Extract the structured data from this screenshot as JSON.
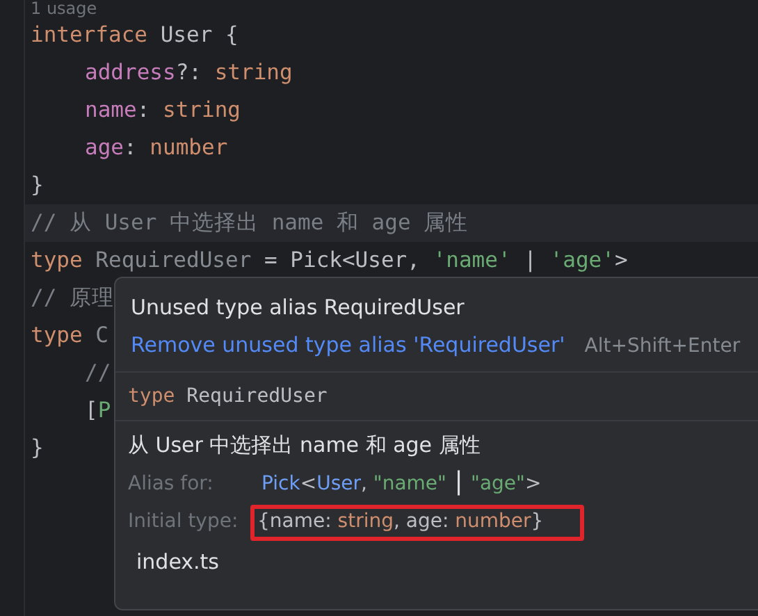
{
  "editor": {
    "usage_hint": "1 usage",
    "lines": [
      {
        "highlighted": false,
        "tokens": [
          {
            "kind": "keyword",
            "text": "interface "
          },
          {
            "kind": "plain",
            "text": "User {"
          }
        ]
      },
      {
        "highlighted": false,
        "indent": true,
        "tokens": [
          {
            "kind": "prop",
            "text": "address"
          },
          {
            "kind": "plain",
            "text": "?: "
          },
          {
            "kind": "keyword",
            "text": "string"
          }
        ]
      },
      {
        "highlighted": false,
        "indent": true,
        "tokens": [
          {
            "kind": "prop",
            "text": "name"
          },
          {
            "kind": "plain",
            "text": ": "
          },
          {
            "kind": "keyword",
            "text": "string"
          }
        ]
      },
      {
        "highlighted": false,
        "indent": true,
        "tokens": [
          {
            "kind": "prop",
            "text": "age"
          },
          {
            "kind": "plain",
            "text": ": "
          },
          {
            "kind": "keyword",
            "text": "number"
          }
        ]
      },
      {
        "highlighted": false,
        "tokens": [
          {
            "kind": "plain",
            "text": "}"
          }
        ]
      },
      {
        "highlighted": true,
        "tokens": [
          {
            "kind": "comment",
            "text": "// 从 User 中选择出 name 和 age 属性"
          }
        ]
      },
      {
        "highlighted": false,
        "tokens": [
          {
            "kind": "keyword",
            "text": "type "
          },
          {
            "kind": "unused",
            "text": "RequiredUser"
          },
          {
            "kind": "plain",
            "text": " = Pick<User, "
          },
          {
            "kind": "string",
            "text": "'name'"
          },
          {
            "kind": "plain",
            "text": " | "
          },
          {
            "kind": "string",
            "text": "'age'"
          },
          {
            "kind": "plain",
            "text": ">"
          }
        ]
      },
      {
        "highlighted": false,
        "tokens": [
          {
            "kind": "comment",
            "text": "// 原理"
          }
        ]
      },
      {
        "highlighted": false,
        "tokens": [
          {
            "kind": "keyword",
            "text": "type "
          },
          {
            "kind": "unused",
            "text": "C"
          }
        ]
      },
      {
        "highlighted": false,
        "indent": true,
        "tokens": [
          {
            "kind": "comment",
            "text": "//"
          }
        ]
      },
      {
        "highlighted": false,
        "indent": true,
        "tokens": [
          {
            "kind": "plain",
            "text": "["
          },
          {
            "kind": "string",
            "text": "P"
          }
        ]
      },
      {
        "highlighted": false,
        "tokens": [
          {
            "kind": "plain",
            "text": "}"
          }
        ]
      }
    ]
  },
  "popup": {
    "problem": "Unused type alias RequiredUser",
    "fix": {
      "label": "Remove unused type alias 'RequiredUser'",
      "shortcut": "Alt+Shift+Enter"
    },
    "declaration": [
      {
        "kind": "keyword",
        "text": "type "
      },
      {
        "kind": "plain",
        "text": "RequiredUser"
      }
    ],
    "doc": "从 User 中选择出 name 和 age 属性",
    "alias_for": {
      "label": "Alias for:",
      "tokens": [
        {
          "kind": "ref",
          "text": "Pick"
        },
        {
          "kind": "plain",
          "text": "<"
        },
        {
          "kind": "ref",
          "text": "User"
        },
        {
          "kind": "plain",
          "text": ", "
        },
        {
          "kind": "string",
          "text": "\"name\""
        },
        {
          "kind": "bar",
          "text": " | "
        },
        {
          "kind": "string",
          "text": "\"age\""
        },
        {
          "kind": "plain",
          "text": ">"
        }
      ]
    },
    "initial_type": {
      "label": "Initial type:",
      "tokens": [
        {
          "kind": "plain",
          "text": "{name: "
        },
        {
          "kind": "keyword",
          "text": "string"
        },
        {
          "kind": "plain",
          "text": ", age: "
        },
        {
          "kind": "keyword",
          "text": "number"
        },
        {
          "kind": "plain",
          "text": "}"
        }
      ]
    },
    "file": "index.ts"
  }
}
